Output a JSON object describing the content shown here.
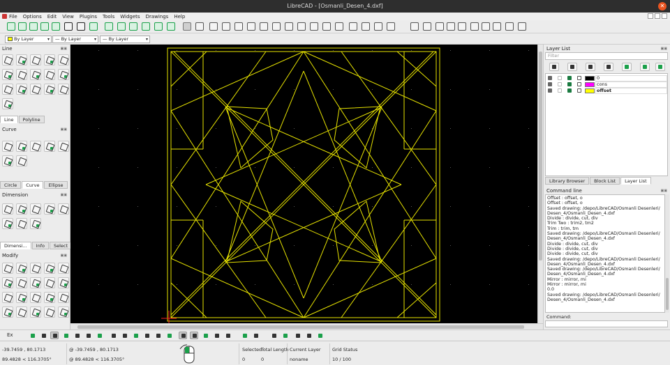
{
  "window": {
    "title": "LibreCAD - [Osmanli_Desen_4.dxf]",
    "close": "✕"
  },
  "menu": [
    "File",
    "Options",
    "Edit",
    "View",
    "Plugins",
    "Tools",
    "Widgets",
    "Drawings",
    "Help"
  ],
  "combos": {
    "color": "By Layer",
    "width": "By Layer",
    "linetype": "By Layer"
  },
  "left": {
    "line_title": "Line",
    "line_tabs": [
      "Line",
      "Polyline"
    ],
    "curve_title": "Curve",
    "curve_tabs": [
      "Circle",
      "Curve",
      "Ellipse"
    ],
    "dimension_title": "Dimension",
    "dimension_tabs": [
      "Dimensi...",
      "Info",
      "Select"
    ],
    "modify_title": "Modify"
  },
  "right": {
    "layer_list_title": "Layer List",
    "filter_placeholder": "Filter",
    "layers": [
      {
        "name": "0",
        "color": "#000000"
      },
      {
        "name": "cons",
        "color": "#ff00ff"
      },
      {
        "name": "offset",
        "color": "#ffff00"
      }
    ],
    "tabs": [
      "Library Browser",
      "Block List",
      "Layer List"
    ],
    "command_line_title": "Command line",
    "history": [
      "Offset : offset, o",
      "Offset : offset, o",
      "Saved drawing: /depo/LibreCAD/Osmanli Desenleri/",
      "Desen_4/Osmanli_Desen_4.dxf",
      "Divide : divide, cut, div",
      "Trim Two : trim2, tm2",
      "Trim : trim, tm",
      "Saved drawing: /depo/LibreCAD/Osmanli Desenleri/",
      "Desen_4/Osmanli_Desen_4.dxf",
      "Divide : divide, cut, div",
      "Divide : divide, cut, div",
      "Divide : divide, cut, div",
      "Saved drawing: /depo/LibreCAD/Osmanli Desenleri/",
      "Desen_4/Osmanli_Desen_4.dxf",
      "Saved drawing: /depo/LibreCAD/Osmanli Desenleri/",
      "Desen_4/Osmanli_Desen_4.dxf",
      "Mirror : mirror, mi",
      "Mirror : mirror, mi",
      "0.0",
      "Saved drawing: /depo/LibreCAD/Osmanli Desenleri/",
      "Desen_4/Osmanli_Desen_4.dxf"
    ],
    "command_label": "Command:"
  },
  "snap": {
    "ex_label": "Ex"
  },
  "status": {
    "abs_coord": "-39.7459 , 80.1713",
    "abs_polar": "89.4828 < 116.3705°",
    "rel_coord": "@  -39.7459 , 80.1713",
    "rel_polar": "@  89.4828 < 116.3705°",
    "selected_label": "Selected",
    "selected_value": "0",
    "total_length_label": "Total Length",
    "total_length_value": "0",
    "current_layer_label": "Current Layer",
    "current_layer_value": "noname",
    "grid_status_label": "Grid Status",
    "grid_status_value": "10 / 100"
  },
  "colors": {
    "drawing": "#e8e400",
    "accent": "#1aa04a",
    "close": "#e95420"
  }
}
